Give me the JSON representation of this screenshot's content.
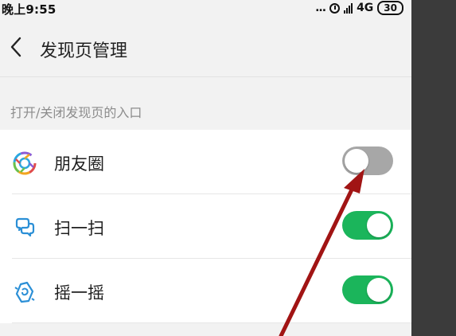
{
  "status_bar": {
    "time": "晚上9:55",
    "dots": "...",
    "network": "4G",
    "battery": "30"
  },
  "header": {
    "title": "发现页管理"
  },
  "section": {
    "label": "打开/关闭发现页的入口"
  },
  "items": [
    {
      "label": "朋友圈",
      "icon": "moments-icon",
      "enabled": false
    },
    {
      "label": "扫一扫",
      "icon": "scan-icon",
      "enabled": true
    },
    {
      "label": "摇一摇",
      "icon": "shake-icon",
      "enabled": true
    }
  ],
  "colors": {
    "toggle_on": "#1bb55b",
    "toggle_off": "#a7a7a7",
    "arrow": "#a11414"
  }
}
